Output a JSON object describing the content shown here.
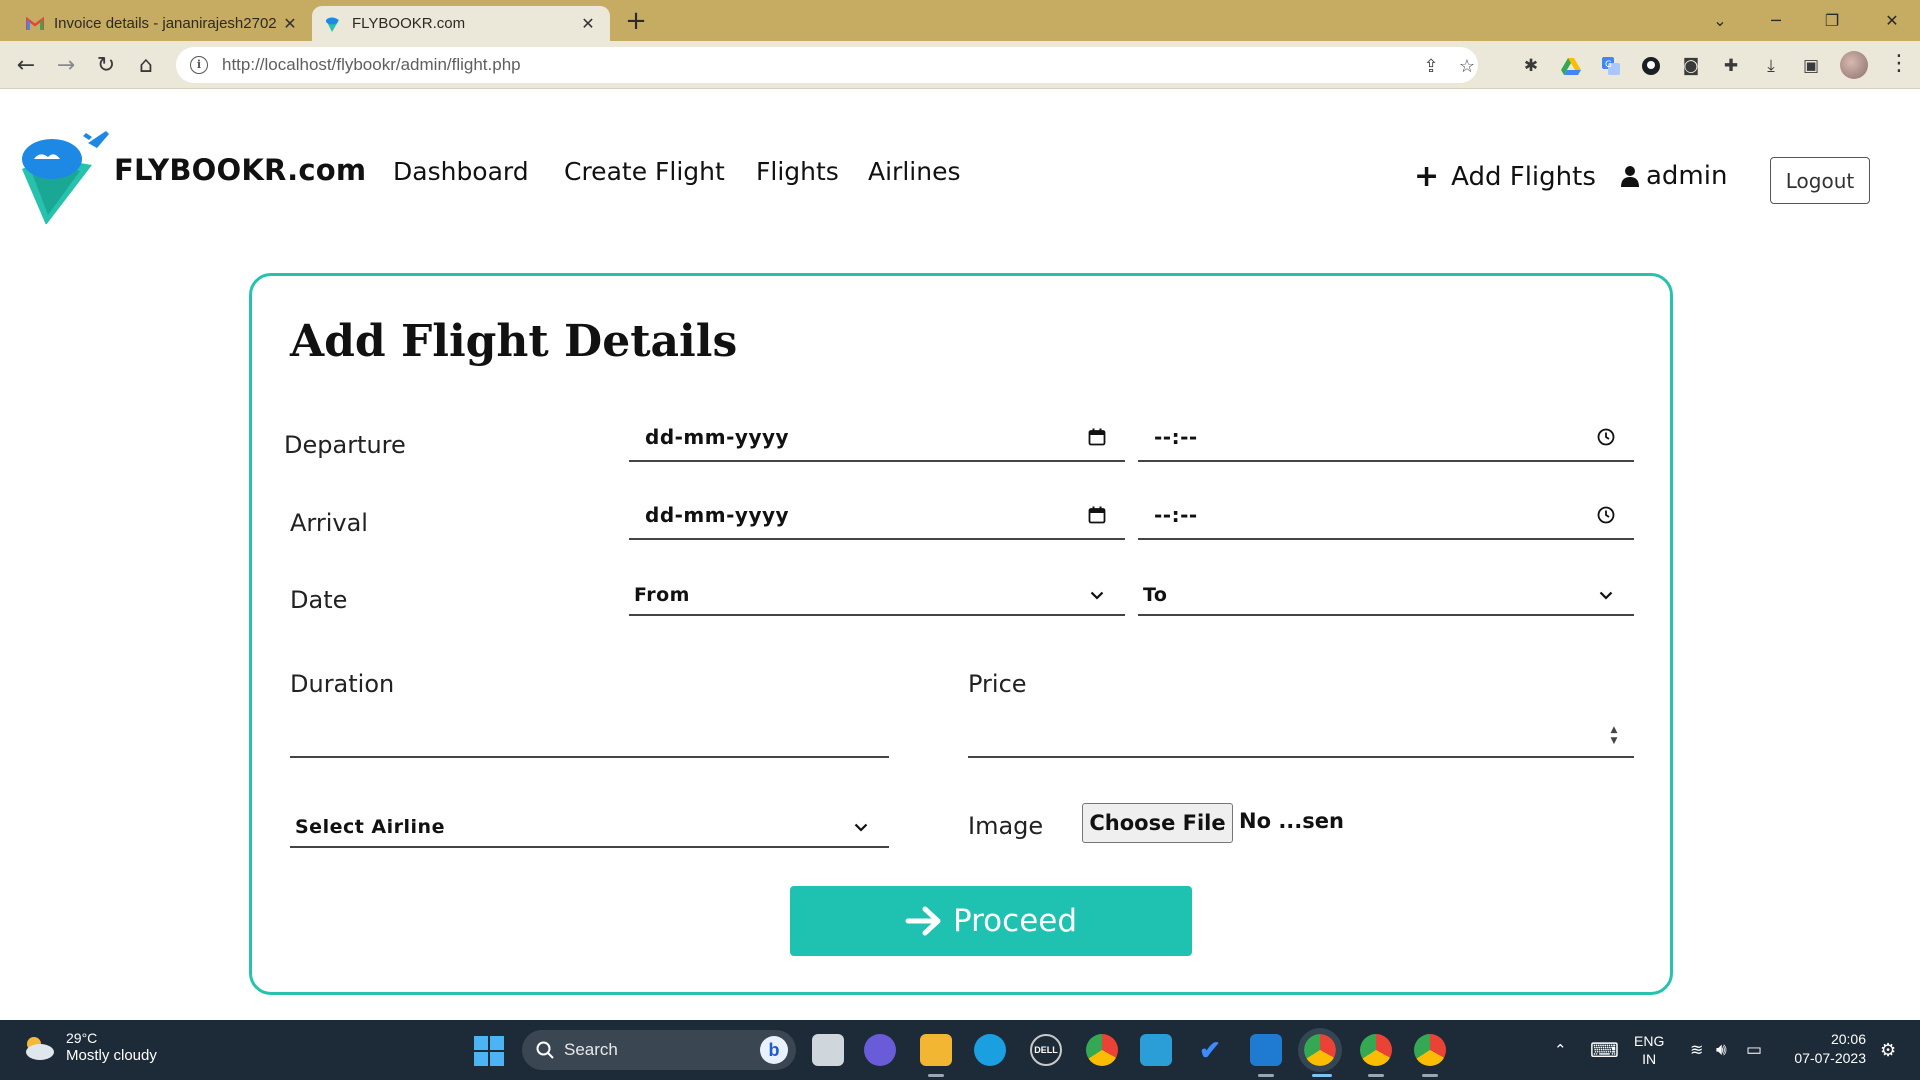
{
  "browser": {
    "tabs": [
      {
        "title": "Invoice details - jananirajesh2702",
        "icon": "gmail-icon",
        "active": false
      },
      {
        "title": "FLYBOOKR.com",
        "icon": "flybookr-favicon",
        "active": true
      }
    ],
    "url": "http://localhost/flybookr/admin/flight.php"
  },
  "site": {
    "brand": "FLYBOOKR.com",
    "nav": [
      "Dashboard",
      "Create Flight",
      "Flights",
      "Airlines"
    ],
    "add_flights": "Add Flights",
    "user": "admin",
    "logout": "Logout",
    "accent_color": "#26c2ae"
  },
  "form": {
    "title": "Add Flight Details",
    "departure_label": "Departure",
    "arrival_label": "Arrival",
    "date_label": "Date",
    "duration_label": "Duration",
    "price_label": "Price",
    "image_label": "Image",
    "departure_date": "dd-mm-yyyy",
    "departure_time": "--:--",
    "arrival_date": "dd-mm-yyyy",
    "arrival_time": "--:--",
    "from_select": "From",
    "to_select": "To",
    "duration_value": "",
    "price_value": "",
    "airline_select": "Select Airline",
    "file_button": "Choose File",
    "file_status": "No ...sen",
    "submit": "Proceed"
  },
  "taskbar": {
    "weather_temp": "29°C",
    "weather_desc": "Mostly cloudy",
    "search_label": "Search",
    "lang_line1": "ENG",
    "lang_line2": "IN",
    "time": "20:06",
    "date": "07-07-2023"
  }
}
